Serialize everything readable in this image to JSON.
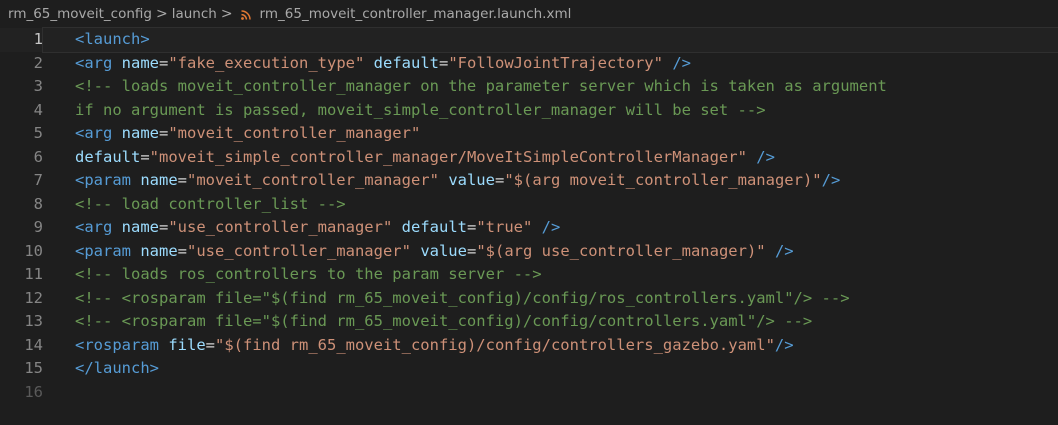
{
  "breadcrumb": {
    "items": [
      "rm_65_moveit_config",
      "launch"
    ],
    "separator": ">",
    "file_name": "rm_65_moveit_controller_manager.launch.xml",
    "file_icon": "rss-icon",
    "file_icon_color": "#e37933"
  },
  "editor": {
    "current_line": 1,
    "colors": {
      "background": "#1e1e1e",
      "tag": "#569cd6",
      "attribute": "#9cdcfe",
      "string": "#ce9178",
      "comment": "#6a9955",
      "text": "#d4d4d4",
      "line_number": "#858585"
    },
    "lines": [
      {
        "n": "1",
        "tokens": [
          [
            "tag",
            "<launch>"
          ]
        ]
      },
      {
        "n": "2",
        "tokens": [
          [
            "tag",
            "<arg "
          ],
          [
            "attr",
            "name"
          ],
          [
            "txt",
            "="
          ],
          [
            "str",
            "\"fake_execution_type\""
          ],
          [
            "txt",
            " "
          ],
          [
            "attr",
            "default"
          ],
          [
            "txt",
            "="
          ],
          [
            "str",
            "\"FollowJointTrajectory\""
          ],
          [
            "txt",
            " "
          ],
          [
            "tag",
            "/>"
          ]
        ]
      },
      {
        "n": "3",
        "tokens": [
          [
            "com",
            "<!-- loads moveit_controller_manager on the parameter server which is taken as argument"
          ]
        ]
      },
      {
        "n": "4",
        "tokens": [
          [
            "com",
            "if no argument is passed, moveit_simple_controller_manager will be set -->"
          ]
        ]
      },
      {
        "n": "5",
        "tokens": [
          [
            "tag",
            "<arg "
          ],
          [
            "attr",
            "name"
          ],
          [
            "txt",
            "="
          ],
          [
            "str",
            "\"moveit_controller_manager\""
          ]
        ]
      },
      {
        "n": "6",
        "tokens": [
          [
            "attr",
            "default"
          ],
          [
            "txt",
            "="
          ],
          [
            "str",
            "\"moveit_simple_controller_manager/MoveItSimpleControllerManager\""
          ],
          [
            "txt",
            " "
          ],
          [
            "tag",
            "/>"
          ]
        ]
      },
      {
        "n": "7",
        "tokens": [
          [
            "tag",
            "<param "
          ],
          [
            "attr",
            "name"
          ],
          [
            "txt",
            "="
          ],
          [
            "str",
            "\"moveit_controller_manager\""
          ],
          [
            "txt",
            " "
          ],
          [
            "attr",
            "value"
          ],
          [
            "txt",
            "="
          ],
          [
            "str",
            "\"$(arg moveit_controller_manager)\""
          ],
          [
            "tag",
            "/>"
          ]
        ]
      },
      {
        "n": "8",
        "tokens": [
          [
            "com",
            "<!-- load controller_list -->"
          ]
        ]
      },
      {
        "n": "9",
        "tokens": [
          [
            "tag",
            "<arg "
          ],
          [
            "attr",
            "name"
          ],
          [
            "txt",
            "="
          ],
          [
            "str",
            "\"use_controller_manager\""
          ],
          [
            "txt",
            " "
          ],
          [
            "attr",
            "default"
          ],
          [
            "txt",
            "="
          ],
          [
            "str",
            "\"true\""
          ],
          [
            "txt",
            " "
          ],
          [
            "tag",
            "/>"
          ]
        ]
      },
      {
        "n": "10",
        "tokens": [
          [
            "tag",
            "<param "
          ],
          [
            "attr",
            "name"
          ],
          [
            "txt",
            "="
          ],
          [
            "str",
            "\"use_controller_manager\""
          ],
          [
            "txt",
            " "
          ],
          [
            "attr",
            "value"
          ],
          [
            "txt",
            "="
          ],
          [
            "str",
            "\"$(arg use_controller_manager)\""
          ],
          [
            "txt",
            " "
          ],
          [
            "tag",
            "/>"
          ]
        ]
      },
      {
        "n": "11",
        "tokens": [
          [
            "com",
            "<!-- loads ros_controllers to the param server -->"
          ]
        ]
      },
      {
        "n": "12",
        "tokens": [
          [
            "com",
            "<!-- <rosparam file=\"$(find rm_65_moveit_config)/config/ros_controllers.yaml\"/> -->"
          ]
        ]
      },
      {
        "n": "13",
        "tokens": [
          [
            "com",
            "<!-- <rosparam file=\"$(find rm_65_moveit_config)/config/controllers.yaml\"/> -->"
          ]
        ]
      },
      {
        "n": "14",
        "tokens": [
          [
            "tag",
            "<rosparam "
          ],
          [
            "attr",
            "file"
          ],
          [
            "txt",
            "="
          ],
          [
            "str",
            "\"$(find rm_65_moveit_config)/config/controllers_gazebo.yaml\""
          ],
          [
            "tag",
            "/>"
          ]
        ]
      },
      {
        "n": "15",
        "tokens": [
          [
            "tag",
            "</launch>"
          ]
        ]
      },
      {
        "n": "16",
        "tokens": []
      }
    ]
  }
}
